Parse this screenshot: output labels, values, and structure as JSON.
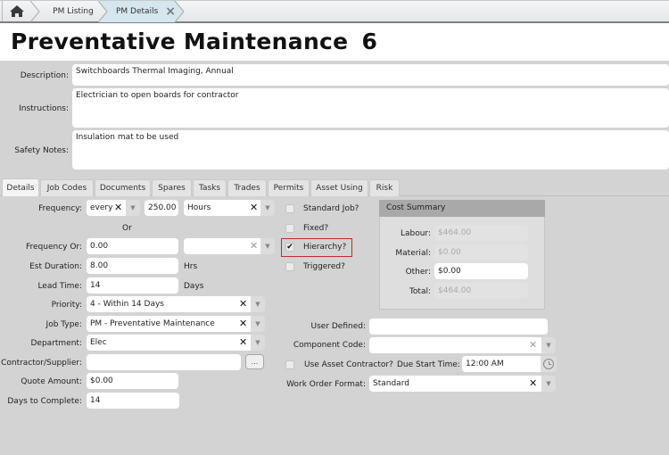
{
  "breadcrumb": {
    "home_icon": "home-icon",
    "items": [
      {
        "label": "PM Listing"
      },
      {
        "label": "PM Details",
        "close_icon": "×"
      }
    ]
  },
  "page": {
    "title_text": "Preventative Maintenance",
    "title_number": "6"
  },
  "header_fields": {
    "description": {
      "label": "Description:",
      "value": "Switchboards Thermal Imaging, Annual"
    },
    "instructions": {
      "label": "Instructions:",
      "value": "Electrician to open boards for contractor"
    },
    "safety_notes": {
      "label": "Safety Notes:",
      "value": "Insulation mat to be used"
    }
  },
  "tabs": [
    {
      "label": "Details",
      "active": true
    },
    {
      "label": "Job Codes"
    },
    {
      "label": "Documents"
    },
    {
      "label": "Spares"
    },
    {
      "label": "Tasks"
    },
    {
      "label": "Trades"
    },
    {
      "label": "Permits"
    },
    {
      "label": "Asset Using"
    },
    {
      "label": "Risk"
    }
  ],
  "details": {
    "frequency": {
      "label": "Frequency:",
      "mode": "every",
      "value": "250.00",
      "unit": "Hours"
    },
    "or_label": "Or",
    "frequency_or": {
      "label": "Frequency Or:",
      "value": "0.00",
      "unit": ""
    },
    "est_duration": {
      "label": "Est Duration:",
      "value": "8.00",
      "suffix": "Hrs"
    },
    "lead_time": {
      "label": "Lead Time:",
      "value": "14",
      "suffix": "Days"
    },
    "priority": {
      "label": "Priority:",
      "value": "4 - Within 14 Days"
    },
    "job_type": {
      "label": "Job Type:",
      "value": "PM - Preventative Maintenance"
    },
    "department": {
      "label": "Department:",
      "value": "Elec"
    },
    "contractor": {
      "label": "Contractor/Supplier:",
      "value": "",
      "button": "..."
    },
    "quote_amount": {
      "label": "Quote Amount:",
      "value": "$0.00"
    },
    "days_to_complete": {
      "label": "Days to Complete:",
      "value": "14"
    }
  },
  "checkboxes": [
    {
      "label": "Standard Job?",
      "checked": false
    },
    {
      "label": "Fixed?",
      "checked": false
    },
    {
      "label": "Hierarchy?",
      "checked": true
    },
    {
      "label": "Triggered?",
      "checked": false
    }
  ],
  "cost_summary": {
    "title": "Cost Summary",
    "labour": {
      "label": "Labour:",
      "value": "$464.00"
    },
    "material": {
      "label": "Material:",
      "value": "$0.00"
    },
    "other": {
      "label": "Other:",
      "value": "$0.00"
    },
    "total": {
      "label": "Total:",
      "value": "$464.00"
    }
  },
  "extra": {
    "user_defined": {
      "label": "User Defined:",
      "value": ""
    },
    "component_code": {
      "label": "Component Code:",
      "value": ""
    },
    "use_asset_contractor": {
      "label": "Use Asset Contractor?",
      "checked": false
    },
    "due_start_time": {
      "label": "Due Start Time:",
      "value": "12:00 AM"
    },
    "work_order_format": {
      "label": "Work Order Format:",
      "value": "Standard"
    }
  },
  "colors": {
    "highlight": "#c62828",
    "active_breadcrumb": "#d4e6ee",
    "background": "#d3d3d3"
  }
}
